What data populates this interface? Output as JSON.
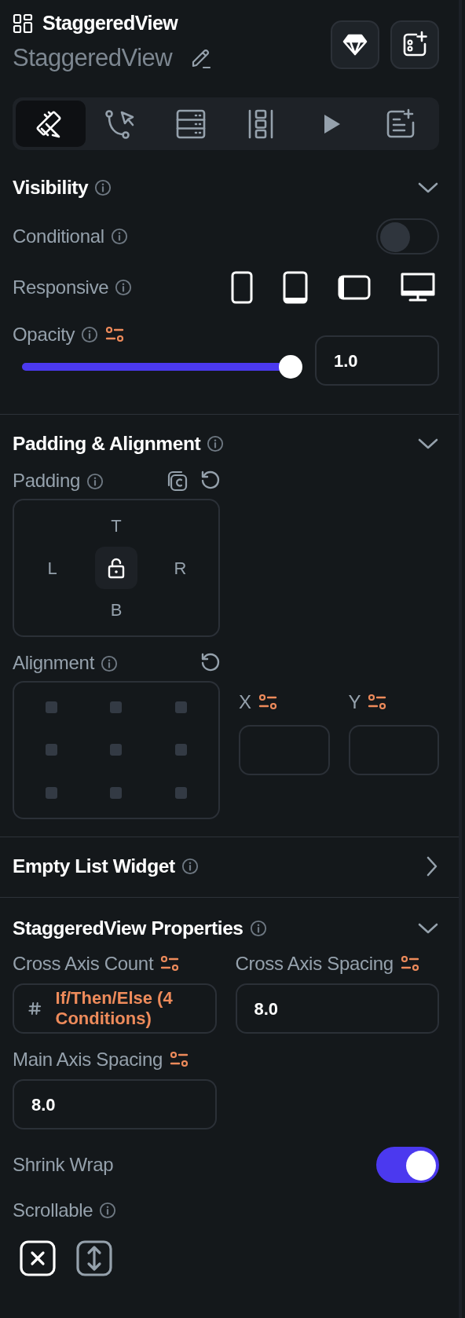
{
  "header": {
    "title": "StaggeredView",
    "name": "StaggeredView"
  },
  "tabs": [
    {
      "kind": "design",
      "selected": true
    },
    {
      "kind": "actions",
      "selected": false
    },
    {
      "kind": "backend",
      "selected": false
    },
    {
      "kind": "layout",
      "selected": false
    },
    {
      "kind": "run",
      "selected": false
    },
    {
      "kind": "notes",
      "selected": false
    }
  ],
  "visibility": {
    "title": "Visibility",
    "expanded": true,
    "conditional": {
      "label": "Conditional",
      "on": false
    },
    "responsive": {
      "label": "Responsive",
      "devices": [
        {
          "kind": "phone",
          "on": true
        },
        {
          "kind": "tablet",
          "on": true
        },
        {
          "kind": "landscape",
          "on": true
        },
        {
          "kind": "desktop",
          "on": true
        }
      ]
    },
    "opacity": {
      "label": "Opacity",
      "level": 1.0,
      "value": "1.0"
    }
  },
  "padding_alignment": {
    "title": "Padding & Alignment",
    "expanded": true,
    "padding": {
      "label": "Padding",
      "top": "T",
      "left": "L",
      "right": "R",
      "bottom": "B"
    },
    "alignment": {
      "label": "Alignment",
      "x": {
        "label": "X"
      },
      "y": {
        "label": "Y"
      }
    }
  },
  "empty_list_widget": {
    "title": "Empty List Widget",
    "expanded": false
  },
  "properties": {
    "title": "StaggeredView Properties",
    "expanded": true,
    "cross_axis_count": {
      "label": "Cross Axis Count",
      "value": "If/Then/Else (4 Conditions)"
    },
    "cross_axis_spacing": {
      "label": "Cross Axis Spacing",
      "value": "8.0"
    },
    "main_axis_spacing": {
      "label": "Main Axis Spacing",
      "value": "8.0"
    },
    "shrink_wrap": {
      "label": "Shrink Wrap",
      "on": true
    },
    "scrollable": {
      "label": "Scrollable",
      "options": [
        {
          "kind": "none",
          "selected": true
        },
        {
          "kind": "vertical",
          "selected": false
        }
      ]
    }
  }
}
